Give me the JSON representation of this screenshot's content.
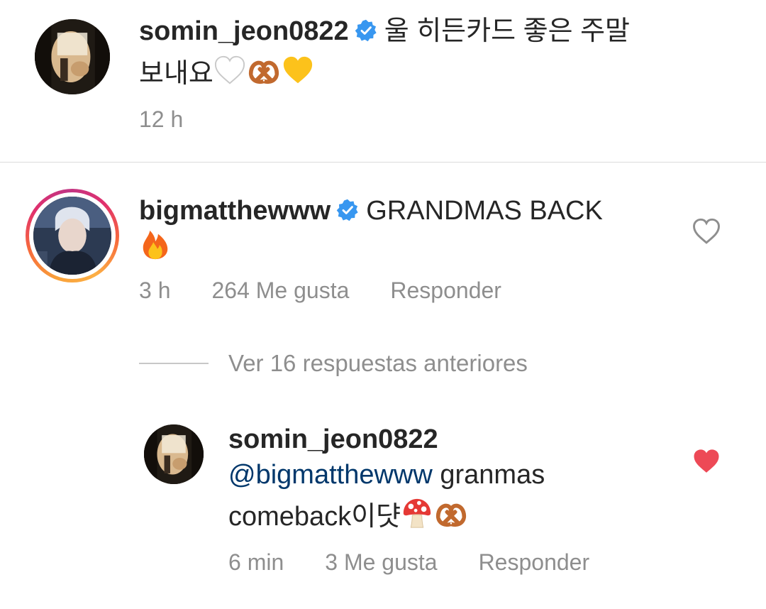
{
  "comments": [
    {
      "username": "somin_jeon0822",
      "verified": true,
      "text_line1": "울 히든카드 좋은 주말",
      "text_line2": "보내요",
      "time": "12 h"
    },
    {
      "username": "bigmatthewww",
      "verified": true,
      "text": "GRANDMAS BACK",
      "time": "3 h",
      "likes": "264 Me gusta",
      "reply_label": "Responder",
      "liked": false
    }
  ],
  "view_previous_replies": "Ver 16 respuestas anteriores",
  "reply": {
    "username": "somin_jeon0822",
    "mention": "@bigmatthewww",
    "text_line1_rest": "granmas",
    "text_line2": "comeback이댯",
    "time": "6 min",
    "likes": "3 Me gusta",
    "reply_label": "Responder",
    "liked": true
  },
  "icons": [
    "avatar",
    "verified-badge-icon",
    "white-heart-emoji",
    "pretzel-emoji",
    "yellow-heart-emoji",
    "fire-emoji",
    "mushroom-emoji",
    "heart-outline-icon",
    "heart-filled-icon"
  ],
  "colors": {
    "verified_blue": "#3897f0",
    "like_red": "#ed4956",
    "mention_blue": "#00376b",
    "meta_gray": "#8e8e8e"
  }
}
